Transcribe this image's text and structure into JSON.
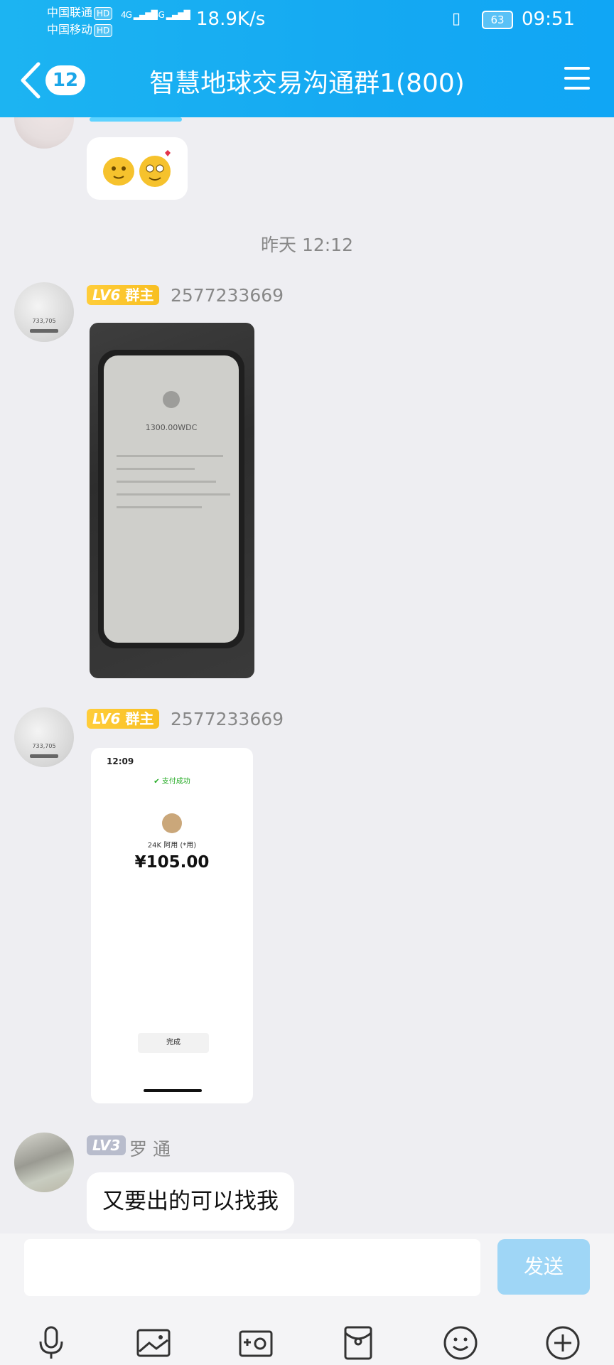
{
  "status_bar": {
    "carrier1": "中国联通",
    "carrier2": "中国移动",
    "hd": "HD",
    "net1": "4G",
    "net2": "4G",
    "speed": "18.9K/s",
    "battery": "63",
    "time": "09:51"
  },
  "header": {
    "back_count": "12",
    "title": "智慧地球交易沟通群1(800)"
  },
  "messages": {
    "timestamp": "昨天 12:12",
    "msg1": {
      "level": "LV6",
      "role": "群主",
      "user": "2577233669"
    },
    "msg1_image": {
      "amount": "1300.00WDC"
    },
    "msg2": {
      "level": "LV6",
      "role": "群主",
      "user": "2577233669"
    },
    "msg2_image": {
      "time": "12:09",
      "status": "支付成功",
      "payee": "24K 阿用 (*用)",
      "amount": "¥105.00",
      "done_button": "完成"
    },
    "msg3": {
      "level": "LV3",
      "user": "罗 通",
      "text": "又要出的可以找我"
    }
  },
  "input_bar": {
    "send_label": "发送"
  },
  "colors": {
    "header": "#15a9f2",
    "send_button": "#9fd6f6",
    "owner_tag": "#f8bf22"
  },
  "icons": [
    "microphone-icon",
    "image-icon",
    "camera-icon",
    "red-packet-icon",
    "emoji-icon",
    "plus-icon"
  ]
}
